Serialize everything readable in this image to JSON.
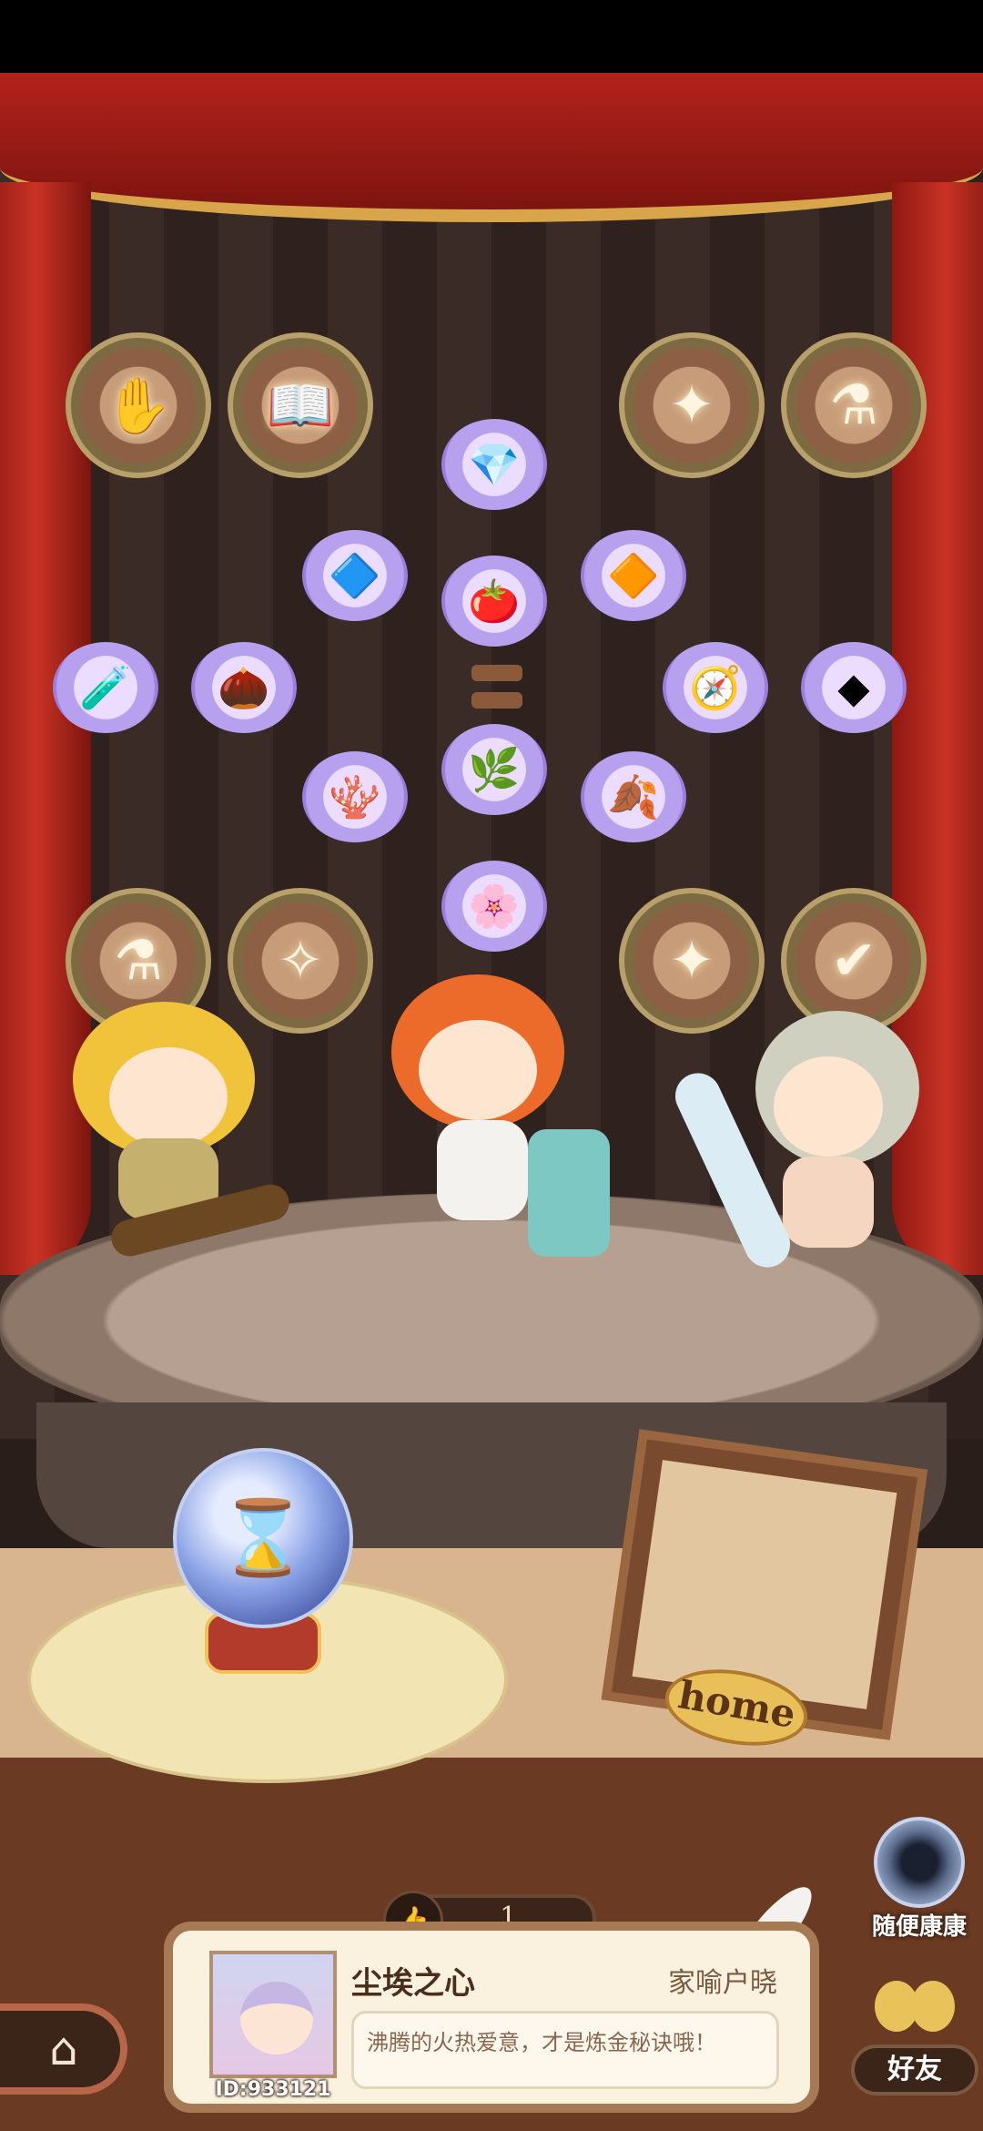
{
  "stage": {
    "medals_top": [
      {
        "icon": "hand-plant-medal-icon",
        "glyph": "✋"
      },
      {
        "icon": "book-medal-icon",
        "glyph": "📖"
      },
      {
        "icon": "sparkle-flower-medal-icon",
        "glyph": "✦"
      },
      {
        "icon": "cauldron-medal-icon",
        "glyph": "⚗"
      }
    ],
    "medals_bottom": [
      {
        "icon": "cauldron-medal-icon",
        "glyph": "⚗"
      },
      {
        "icon": "fairy-medal-icon",
        "glyph": "✧"
      },
      {
        "icon": "sparkle-flower-medal-icon",
        "glyph": "✦"
      },
      {
        "icon": "scroll-check-medal-icon",
        "glyph": "✔"
      }
    ],
    "ingredients": [
      {
        "name": "crystal-ingredient-icon",
        "glyph": "💎"
      },
      {
        "name": "blue-powder-ingredient-icon",
        "glyph": "🔷"
      },
      {
        "name": "tomato-ingredient-icon",
        "glyph": "🍅"
      },
      {
        "name": "amber-ingredient-icon",
        "glyph": "🔶"
      },
      {
        "name": "potion-ingredient-icon",
        "glyph": "🧪"
      },
      {
        "name": "nuts-ingredient-icon",
        "glyph": "🌰"
      },
      {
        "name": "compass-ingredient-icon",
        "glyph": "🧭"
      },
      {
        "name": "stone-ingredient-icon",
        "glyph": "◆"
      },
      {
        "name": "red-coral-ingredient-icon",
        "glyph": "🪸"
      },
      {
        "name": "herb-ingredient-icon",
        "glyph": "🌿"
      },
      {
        "name": "golden-leaf-ingredient-icon",
        "glyph": "🍂"
      },
      {
        "name": "purple-flower-ingredient-icon",
        "glyph": "🌸"
      }
    ]
  },
  "orb": {
    "icon": "hourglass-icon",
    "glyph": "⌛"
  },
  "frame": {
    "label": "home"
  },
  "like": {
    "icon": "thumbs-up-icon",
    "glyph": "👍",
    "count": "1"
  },
  "card": {
    "title": "尘埃之心",
    "author": "家喻户晓",
    "quote": "沸腾的火热爱意，才是炼金秘诀哦！",
    "user_id": "ID:933121"
  },
  "nav": {
    "home_glyph": "⌂",
    "random_label": "随便康康",
    "friends_label": "好友"
  }
}
